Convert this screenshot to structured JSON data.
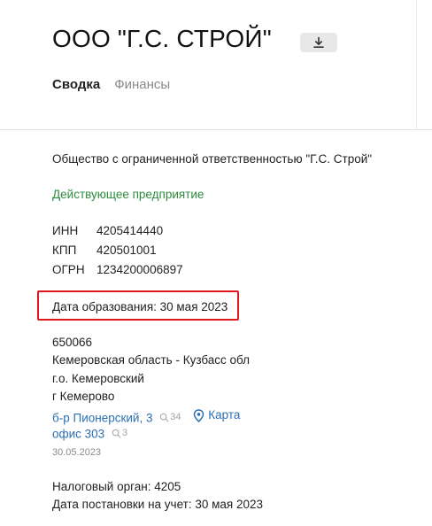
{
  "company": {
    "title": "ООО \"Г.С. СТРОЙ\"",
    "full_name": "Общество с ограниченной ответственностью \"Г.С. Строй\"",
    "status": "Действующее предприятие"
  },
  "tabs": [
    {
      "label": "Сводка",
      "active": true
    },
    {
      "label": "Финансы",
      "active": false
    }
  ],
  "requisites": [
    {
      "label": "ИНН",
      "value": "4205414440"
    },
    {
      "label": "КПП",
      "value": "420501001"
    },
    {
      "label": "ОГРН",
      "value": "1234200006897"
    }
  ],
  "founded": "Дата образования: 30 мая 2023",
  "address": {
    "postcode": "650066",
    "region": "Кемеровская область - Кузбасс обл",
    "district": "г.о. Кемеровский",
    "city": "г Кемерово",
    "street": "б-р Пионерский, 3",
    "street_count": "34",
    "map_label": "Карта",
    "office": "офис 303",
    "office_count": "3",
    "date": "30.05.2023"
  },
  "tax": {
    "authority": "Налоговый орган: 4205",
    "registration": "Дата постановки на учет: 30 мая 2023"
  },
  "colors": {
    "status_green": "#2e8b3e",
    "link_blue": "#2b6fb3",
    "highlight_red": "#e0191f"
  }
}
